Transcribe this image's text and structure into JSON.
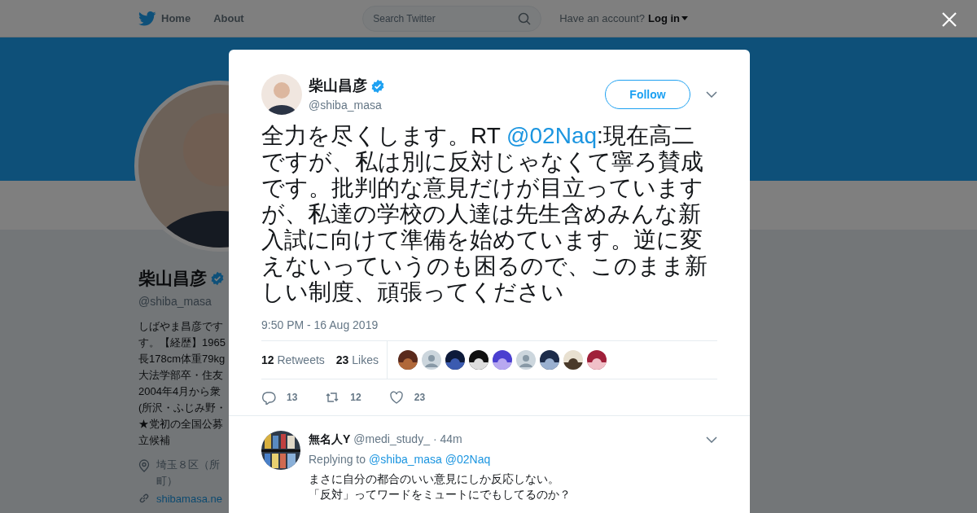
{
  "nav": {
    "items": [
      "Home",
      "About"
    ],
    "search_placeholder": "Search Twitter",
    "account_prompt": "Have an account?",
    "login": "Log in"
  },
  "profile": {
    "name": "柴山昌彦",
    "verified": true,
    "handle": "@shiba_masa",
    "bio_lines": [
      "しばやま昌彦です",
      "す。【経歴】1965",
      "長178cm体重79kg",
      "大法学部卒・住友",
      "2004年4月から衆",
      "(所沢・ふじみ野・",
      "★党初の全国公募",
      "立候補"
    ],
    "location_lines": [
      "埼玉８区（所",
      "町）"
    ],
    "link": "shibamasa.ne"
  },
  "tweet": {
    "author": "柴山昌彦",
    "verified": true,
    "handle": "@shiba_masa",
    "follow": "Follow",
    "text_before": "全力を尽くします。RT ",
    "mention": "@02Naq",
    "text_after": ":現在高二ですが、私は別に反対じゃなくて寧ろ賛成です。批判的な意見だけが目立っていますが、私達の学校の人達は先生含めみんな新入試に向けて準備を始めています。逆に変えないっていうのも困るので、このまま新しい制度、頑張ってください",
    "time": "9:50 PM - 16 Aug 2019",
    "retweets_count": "12",
    "retweets_label": "Retweets",
    "likes_count": "23",
    "likes_label": "Likes",
    "liker_avatars": [
      {
        "kind": "picture"
      },
      {
        "kind": "default"
      },
      {
        "kind": "picture"
      },
      {
        "kind": "picture"
      },
      {
        "kind": "picture"
      },
      {
        "kind": "default"
      },
      {
        "kind": "picture"
      },
      {
        "kind": "picture"
      },
      {
        "kind": "picture"
      }
    ],
    "actions": [
      {
        "kind": "reply",
        "count": "13"
      },
      {
        "kind": "retweet",
        "count": "12"
      },
      {
        "kind": "like",
        "count": "23"
      }
    ]
  },
  "reply": {
    "author": "無名人Y",
    "handle": "@medi_study_",
    "time": "· 44m",
    "replying_label": "Replying to",
    "replying_to": [
      "@shiba_masa",
      "@02Naq"
    ],
    "lines": [
      "まさに自分の都合のいい意見にしか反応しない。",
      "「反対」ってワードをミュートにでもしてるのか？"
    ]
  }
}
